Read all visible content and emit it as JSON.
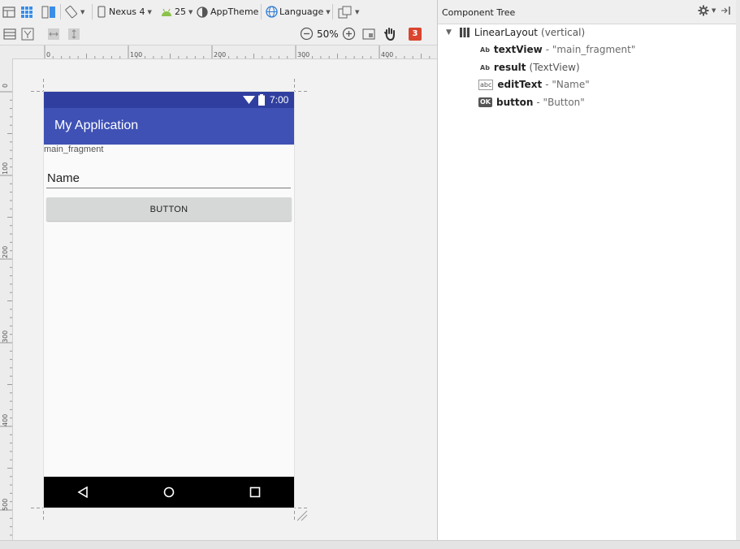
{
  "toolbar": {
    "device": "Nexus 4",
    "api_level": "25",
    "theme": "AppTheme",
    "language": "Language",
    "zoom": "50%",
    "issue_count": "3"
  },
  "rulers": {
    "top": [
      "0",
      "100",
      "200",
      "300",
      "400"
    ],
    "left": [
      "0",
      "100",
      "200",
      "300",
      "400",
      "500"
    ]
  },
  "phone": {
    "time": "7:00",
    "app_title": "My Application",
    "text_view": "main_fragment",
    "edit_text": "Name",
    "button_label": "BUTTON"
  },
  "component_tree": {
    "title": "Component Tree",
    "root": {
      "name": "LinearLayout",
      "detail": "(vertical)"
    },
    "items": [
      {
        "badge": "Ab",
        "id": "textView",
        "detail": "- \"main_fragment\""
      },
      {
        "badge": "Ab",
        "id": "result",
        "detail": "(TextView)"
      },
      {
        "badge": "abc",
        "id": "editText",
        "detail": "- \"Name\""
      },
      {
        "badge": "OK",
        "id": "button",
        "detail": "- \"Button\""
      }
    ]
  },
  "colors": {
    "status_bar": "#303f9f",
    "app_bar": "#3f51b5",
    "issue_badge": "#d9452e"
  }
}
